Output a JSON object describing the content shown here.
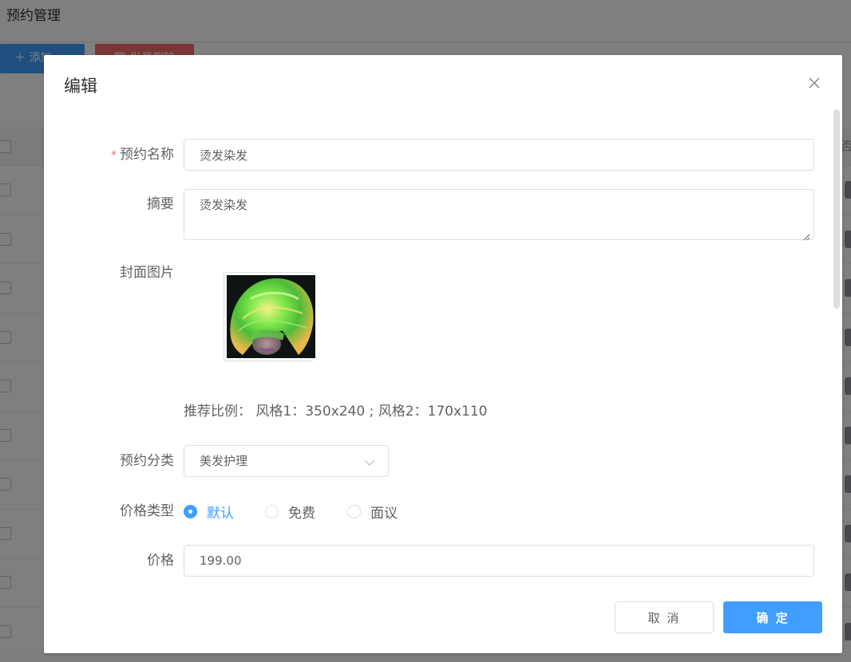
{
  "background": {
    "page_title": "预约管理",
    "add_button_label": "＋ 添加",
    "batch_delete_label": "批量删除",
    "table_header_fragment": "否",
    "row_count": 10
  },
  "dialog": {
    "title": "编辑",
    "fields": {
      "name": {
        "label": "预约名称",
        "required_mark": "*",
        "value": "烫发染发"
      },
      "summary": {
        "label": "摘要",
        "value": "烫发染发"
      },
      "cover": {
        "label": "封面图片",
        "ratio_hint": "推荐比例： 风格1：350x240 ; 风格2：170x110"
      },
      "category": {
        "label": "预约分类",
        "value": "美发护理"
      },
      "price_type": {
        "label": "价格类型",
        "options": [
          {
            "label": "默认",
            "checked": true
          },
          {
            "label": "免费",
            "checked": false
          },
          {
            "label": "面议",
            "checked": false
          }
        ]
      },
      "price": {
        "label": "价格",
        "value": "199.00"
      }
    },
    "footer": {
      "cancel_label": "取 消",
      "confirm_label": "确 定"
    }
  },
  "colors": {
    "primary": "#409eff",
    "danger": "#f56c6c",
    "border": "#dcdfe6",
    "text": "#606266",
    "title": "#303133"
  },
  "icons": {
    "close": "close-icon",
    "select_arrow": "chevron-down-icon",
    "add": "plus-icon",
    "delete": "trash-icon"
  }
}
